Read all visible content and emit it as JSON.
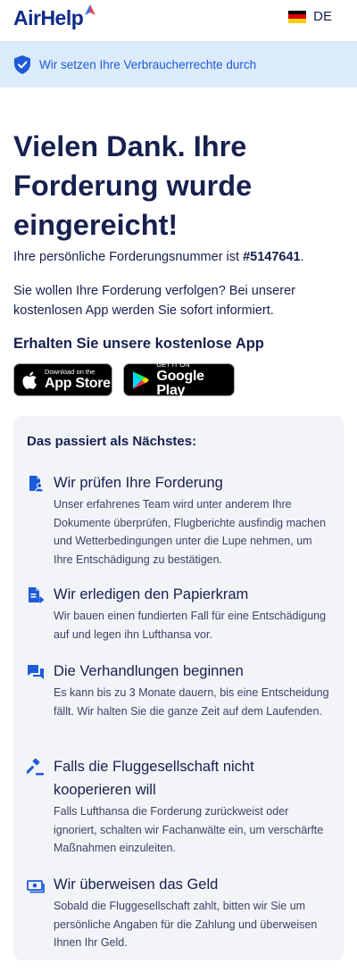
{
  "header": {
    "logo_text": "AirHelp",
    "language_label": "DE",
    "flag_colors": [
      "#000000",
      "#dd0000",
      "#ffce00"
    ],
    "logo_mark_colors": [
      "#e5455a",
      "#3c6ee6"
    ]
  },
  "banner": {
    "icon": "shield-check-icon",
    "text": "Wir setzen Ihre Verbraucherrechte durch"
  },
  "confirmation": {
    "title": "Vielen Dank. Ihre Forderung wurde eingereicht!",
    "claim_prefix": "Ihre persönliche Forderungsnummer ist ",
    "claim_number": "#5147641",
    "claim_suffix": ".",
    "track_text": "Sie wollen Ihre Forderung verfolgen? Bei unserer kostenlosen App werden Sie sofort informiert."
  },
  "app": {
    "heading": "Erhalten Sie unsere kostenlose App",
    "app_store": {
      "small": "Download on the",
      "big": "App Store",
      "icon": "apple-icon"
    },
    "google_play": {
      "small": "GET IT ON",
      "big": "Google Play",
      "icon": "google-play-icon"
    }
  },
  "next": {
    "heading": "Das passiert als Nächstes:",
    "accent_color": "#1e5bd9",
    "steps": [
      {
        "icon": "document-person-icon",
        "title": "Wir prüfen Ihre Forderung",
        "description": "Unser erfahrenes Team wird unter anderem Ihre Dokumente überprüfen, Flugberichte ausfindig machen und Wetterbedingungen unter die Lupe nehmen, um Ihre Entschädigung zu bestätigen."
      },
      {
        "icon": "document-send-icon",
        "title": "Wir erledigen den Papierkram",
        "description": "Wir bauen einen fundierten Fall für eine Entschädigung auf und legen ihn Lufthansa vor."
      },
      {
        "icon": "chat-bubbles-icon",
        "title": "Die Verhandlungen beginnen",
        "description": "Es kann bis zu 3 Monate dauern, bis eine Entscheidung fällt. Wir halten Sie die ganze Zeit auf dem Laufenden."
      },
      {
        "icon": "gavel-icon",
        "title": "Falls die Fluggesellschaft nicht kooperieren will",
        "description": "Falls Lufthansa die Forderung zurückweist oder ignoriert, schalten wir Fachanwälte ein, um verschärfte Maßnahmen einzuleiten."
      },
      {
        "icon": "money-bill-icon",
        "title": "Wir überweisen das Geld",
        "description": "Sobald die Fluggesellschaft zahlt, bitten wir Sie um persönliche Angaben für die Zahlung und überweisen Ihnen Ihr Geld."
      }
    ]
  }
}
